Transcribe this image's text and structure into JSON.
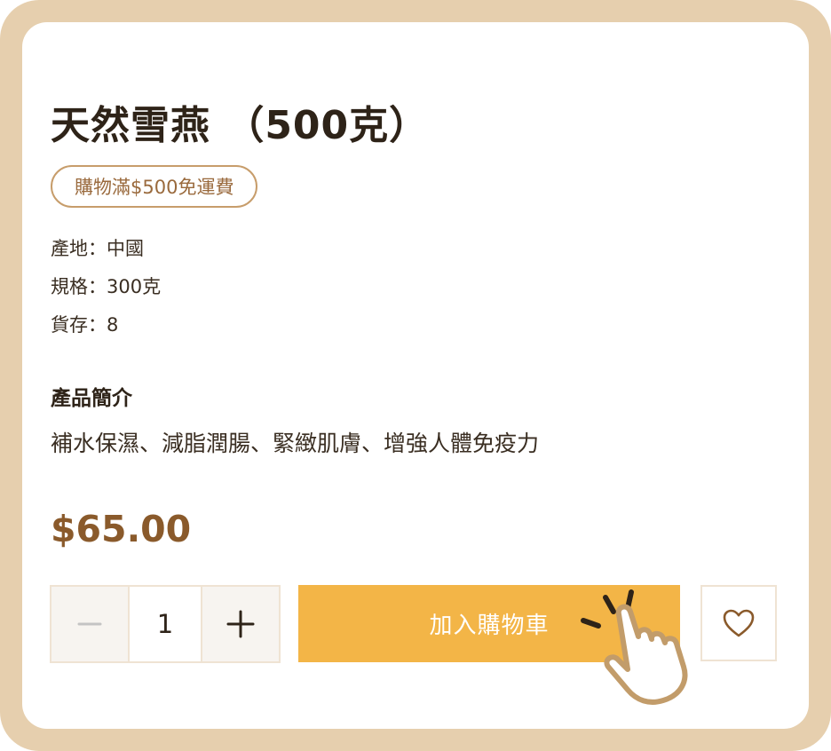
{
  "product": {
    "title": "天然雪燕 （500克）",
    "badge": "購物滿$500免運費",
    "specs": [
      {
        "text": "產地：中國"
      },
      {
        "text": "規格：300克"
      },
      {
        "text": "貨存：8"
      }
    ],
    "intro_heading": "產品簡介",
    "intro_text": "補水保濕、減脂潤腸、緊緻肌膚、增強人體免疫力",
    "price": "$65.00"
  },
  "purchase": {
    "quantity": "1",
    "add_to_cart_label": "加入購物車"
  },
  "icons": {
    "decrease": "minus-icon",
    "increase": "plus-icon",
    "wishlist": "heart-icon",
    "pointer": "pointing-hand-icon"
  },
  "colors": {
    "frame": "#e6cfae",
    "accent": "#f3b547",
    "price": "#8a5a2b",
    "badge_border": "#c79d6b"
  }
}
